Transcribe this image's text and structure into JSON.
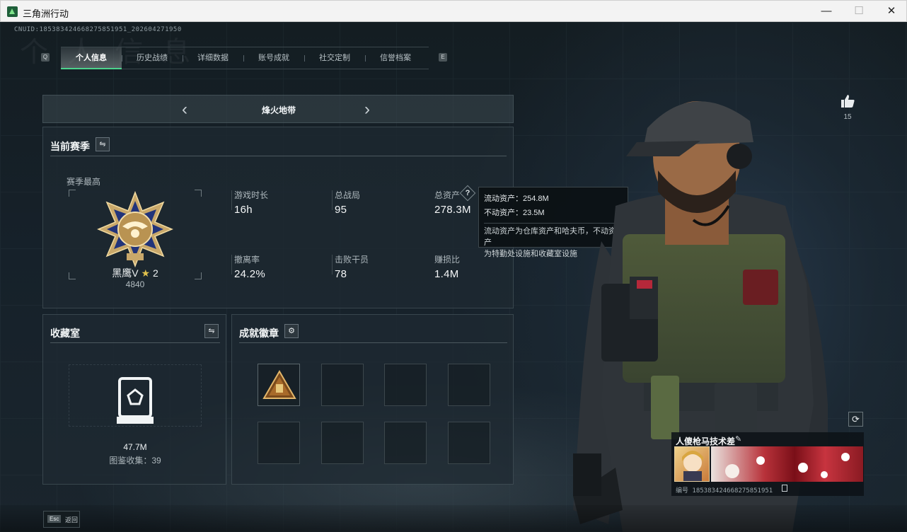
{
  "window": {
    "title": "三角洲行动",
    "minimize": "—",
    "maximize": "☐",
    "close": "✕"
  },
  "header": {
    "uid": "CNUID:185383424668275851951_202604271950",
    "bg_text": "个 人 信 息"
  },
  "tabs": {
    "prev_key": "Q",
    "next_key": "E",
    "items": [
      {
        "label": "个人信息",
        "active": true
      },
      {
        "label": "历史战绩"
      },
      {
        "label": "详细数据"
      },
      {
        "label": "账号成就"
      },
      {
        "label": "社交定制"
      },
      {
        "label": "信誉档案"
      }
    ]
  },
  "mode": {
    "label": "烽火地带",
    "prev": "‹",
    "next": "›"
  },
  "season": {
    "title": "当前赛季",
    "best_label": "赛季最高",
    "rank_name": "黑鹰V",
    "rank_star": "2",
    "rank_points": "4840",
    "stats": [
      {
        "label": "游戏时长",
        "value": "16h"
      },
      {
        "label": "总战局",
        "value": "95"
      },
      {
        "label": "总资产",
        "value": "278.3M"
      },
      {
        "label": "撤离率",
        "value": "24.2%"
      },
      {
        "label": "击败干员",
        "value": "78"
      },
      {
        "label": "赚损比",
        "value": "1.4M"
      }
    ],
    "help": "?"
  },
  "tooltip": {
    "line1": "流动资产：254.8M",
    "line2": "不动资产：23.5M",
    "desc1": "流动资产为仓库资产和哈夫币，不动资产",
    "desc2": "为特勤处设施和收藏室设施"
  },
  "collection": {
    "title": "收藏室",
    "value": "47.7M",
    "count_label": "图鉴收集：39"
  },
  "achievements": {
    "title": "成就徽章",
    "slots": 8
  },
  "like": {
    "count": "15"
  },
  "player": {
    "name": "人傻枪马技术差",
    "id_line": "编号 185383424668275851951"
  },
  "footer": {
    "esc": "Esc",
    "back": "返回"
  },
  "colors": {
    "accent": "#4bd38c",
    "tooltip_bg": "#0c1114"
  }
}
